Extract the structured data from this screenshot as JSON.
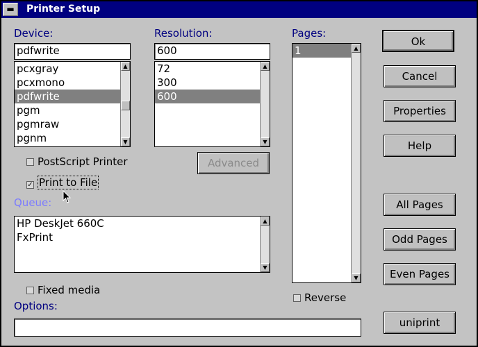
{
  "window": {
    "title": "Printer Setup",
    "sysmenu_icon": "minus-icon"
  },
  "device": {
    "label": "Device:",
    "value": "pdfwrite",
    "items": [
      "pcxgray",
      "pcxmono",
      "pdfwrite",
      "pgm",
      "pgmraw",
      "pgnm"
    ],
    "selected": "pdfwrite"
  },
  "resolution": {
    "label": "Resolution:",
    "value": "600",
    "items": [
      "72",
      "300",
      "600"
    ],
    "selected": "600"
  },
  "pages": {
    "label": "Pages:",
    "items": [
      "1"
    ],
    "selected": "1"
  },
  "options": {
    "postscript_printer": {
      "label": "PostScript Printer",
      "checked": false
    },
    "print_to_file": {
      "label": "Print to File",
      "checked": true
    },
    "fixed_media": {
      "label": "Fixed media",
      "checked": false
    },
    "reverse": {
      "label": "Reverse",
      "checked": false
    },
    "advanced_label": "Advanced",
    "options_label": "Options:",
    "options_value": ""
  },
  "queue": {
    "label": "Queue:",
    "items": [
      "HP DeskJet 660C",
      "FxPrint"
    ]
  },
  "buttons": {
    "ok": "Ok",
    "cancel": "Cancel",
    "properties": "Properties",
    "help": "Help",
    "all_pages": "All Pages",
    "odd_pages": "Odd Pages",
    "even_pages": "Even Pages",
    "uniprint": "uniprint"
  }
}
